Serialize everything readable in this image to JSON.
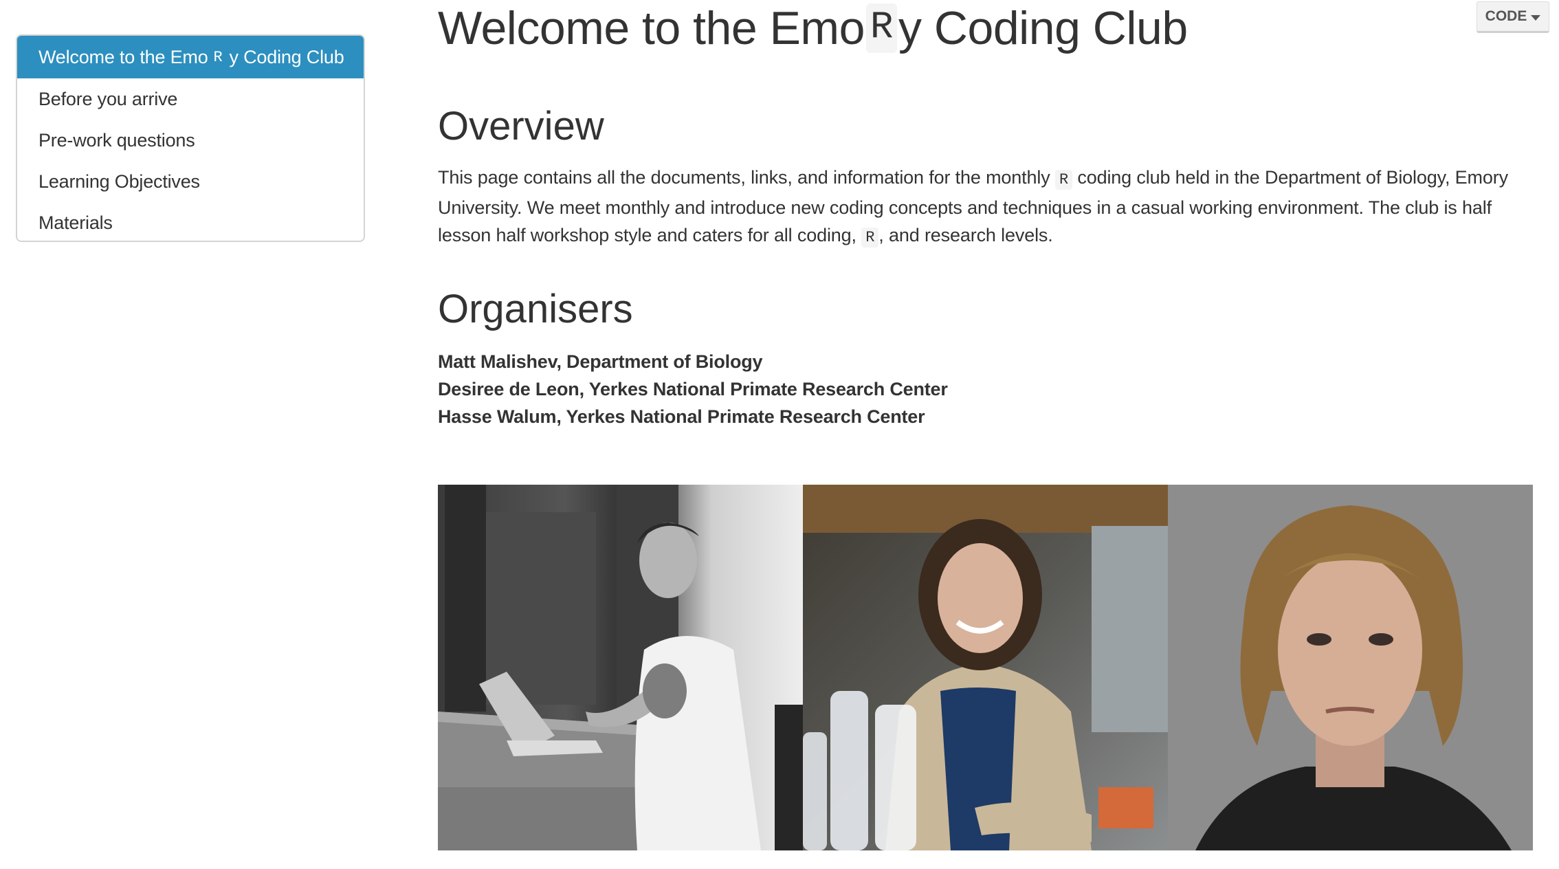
{
  "toc": {
    "items": [
      {
        "label": "Welcome to the Emo",
        "code": "R",
        "suffix": "y Coding Club",
        "active": true
      },
      {
        "label": "Before you arrive"
      },
      {
        "label": "Pre-work questions"
      },
      {
        "label": "Learning Objectives"
      },
      {
        "label": "Materials"
      }
    ]
  },
  "code_button": {
    "label": "CODE",
    "icon": "caret-down-icon"
  },
  "header": {
    "title_pre": "Welcome to the Emo",
    "title_code": "R",
    "title_post": "y Coding Club"
  },
  "overview": {
    "heading": "Overview",
    "text_part1": "This page contains all the documents, links, and information for the monthly",
    "code1": "R",
    "text_part2": "coding club held in the Department of Biology, Emory University. We meet monthly and introduce new coding concepts and techniques in a casual working environment. The club is half lesson half workshop style and caters for all coding,",
    "code2": "R",
    "text_part3": ", and research levels."
  },
  "organisers": {
    "heading": "Organisers",
    "people": [
      "Matt Malishev, Department of Biology",
      "Desiree de Leon, Yerkes National Primate Research Center",
      "Hasse Walum, Yerkes National Primate Research Center"
    ]
  },
  "photos": [
    {
      "name": "organiser-photo-matt"
    },
    {
      "name": "organiser-photo-desiree"
    },
    {
      "name": "organiser-photo-hasse"
    }
  ],
  "colors": {
    "toc_active_bg": "#2c8fbf",
    "text": "#333333"
  }
}
